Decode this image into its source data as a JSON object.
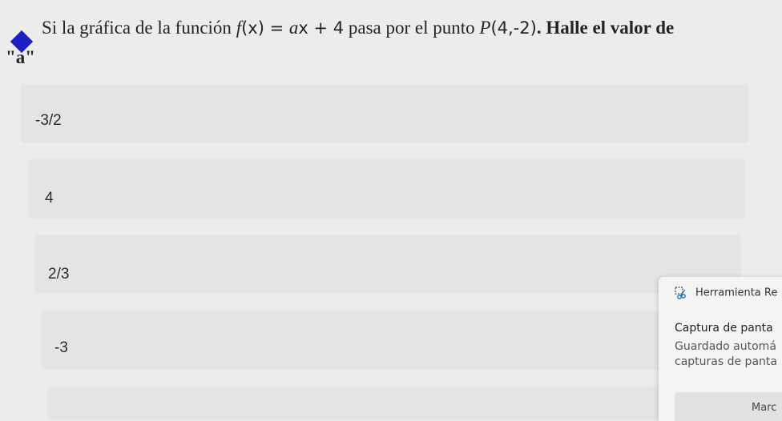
{
  "question": {
    "text_pre": "Si la gráfica de la función ",
    "func_f": "f",
    "func_args": "(x)",
    "func_eq": " = ",
    "func_a": "a",
    "func_x": "x",
    "func_plus": " + 4",
    "text_mid": " pasa por el punto ",
    "point_p": "P",
    "point_coords": "(4,-2)",
    "text_end": ". Halle el valor de",
    "text_line2": "\"a\""
  },
  "options": [
    {
      "label": "-3/2"
    },
    {
      "label": "4"
    },
    {
      "label": "2/3"
    },
    {
      "label": "-3"
    }
  ],
  "notification": {
    "app_name": "Herramienta Re",
    "title": "Captura de panta",
    "body_line1": "Guardado automá",
    "body_line2": "capturas de panta",
    "action_label": "Marc"
  },
  "colors": {
    "bullet": "#1b1fc6",
    "background": "#ececea",
    "option_bg": "#e4e4e2"
  }
}
